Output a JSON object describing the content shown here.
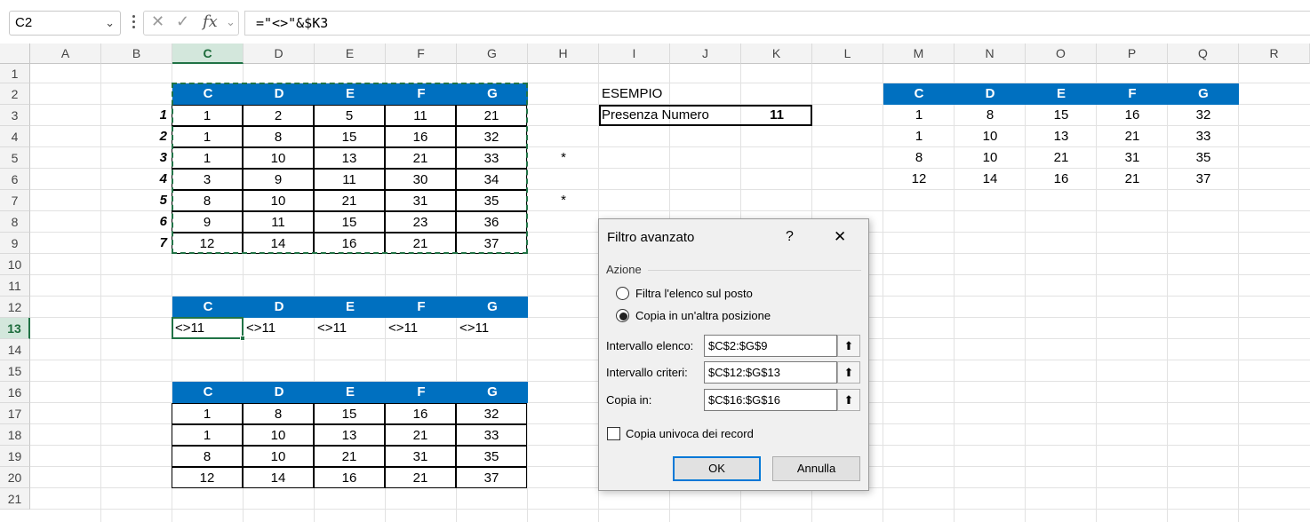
{
  "formula_bar": {
    "name_box": "C2",
    "formula": "=\"<>\"&$K3",
    "fx_label": "fx"
  },
  "columns": [
    "A",
    "B",
    "C",
    "D",
    "E",
    "F",
    "G",
    "H",
    "I",
    "J",
    "K",
    "L",
    "M",
    "N",
    "O",
    "P",
    "Q",
    "R"
  ],
  "rows": [
    "1",
    "2",
    "3",
    "4",
    "5",
    "6",
    "7",
    "8",
    "9",
    "10",
    "11",
    "12",
    "13",
    "14",
    "15",
    "16",
    "17",
    "18",
    "19",
    "20",
    "21"
  ],
  "main_table": {
    "headers": [
      "C",
      "D",
      "E",
      "F",
      "G"
    ],
    "row_numbers": [
      "1",
      "2",
      "3",
      "4",
      "5",
      "6",
      "7"
    ],
    "rows": [
      [
        "1",
        "2",
        "5",
        "11",
        "21"
      ],
      [
        "1",
        "8",
        "15",
        "16",
        "32"
      ],
      [
        "1",
        "10",
        "13",
        "21",
        "33"
      ],
      [
        "3",
        "9",
        "11",
        "30",
        "34"
      ],
      [
        "8",
        "10",
        "21",
        "31",
        "35"
      ],
      [
        "9",
        "11",
        "15",
        "23",
        "36"
      ],
      [
        "12",
        "14",
        "16",
        "21",
        "37"
      ]
    ]
  },
  "markers": {
    "row5": "*",
    "row7": "*"
  },
  "example": {
    "title": "ESEMPIO",
    "label": "Presenza Numero",
    "value": "11"
  },
  "criteria_table": {
    "headers": [
      "C",
      "D",
      "E",
      "F",
      "G"
    ],
    "values": [
      "<>11",
      "<>11",
      "<>11",
      "<>11",
      "<>11"
    ]
  },
  "output_table": {
    "headers": [
      "C",
      "D",
      "E",
      "F",
      "G"
    ],
    "rows": [
      [
        "1",
        "8",
        "15",
        "16",
        "32"
      ],
      [
        "1",
        "10",
        "13",
        "21",
        "33"
      ],
      [
        "8",
        "10",
        "21",
        "31",
        "35"
      ],
      [
        "12",
        "14",
        "16",
        "21",
        "37"
      ]
    ]
  },
  "right_table": {
    "headers": [
      "C",
      "D",
      "E",
      "F",
      "G"
    ],
    "rows": [
      [
        "1",
        "8",
        "15",
        "16",
        "32"
      ],
      [
        "1",
        "10",
        "13",
        "21",
        "33"
      ],
      [
        "8",
        "10",
        "21",
        "31",
        "35"
      ],
      [
        "12",
        "14",
        "16",
        "21",
        "37"
      ]
    ]
  },
  "dialog": {
    "title": "Filtro avanzato",
    "help": "?",
    "close": "✕",
    "group_label": "Azione",
    "radio1": "Filtra l'elenco sul posto",
    "radio2": "Copia in un'altra posizione",
    "list_range_label": "Intervallo elenco:",
    "list_range_value": "$C$2:$G$9",
    "criteria_range_label": "Intervallo criteri:",
    "criteria_range_value": "$C$12:$G$13",
    "copy_to_label": "Copia in:",
    "copy_to_value": "$C$16:$G$16",
    "unique_label": "Copia univoca dei record",
    "ok": "OK",
    "cancel": "Annulla"
  },
  "colors": {
    "header_blue": "#0070c0",
    "excel_green": "#217346"
  }
}
